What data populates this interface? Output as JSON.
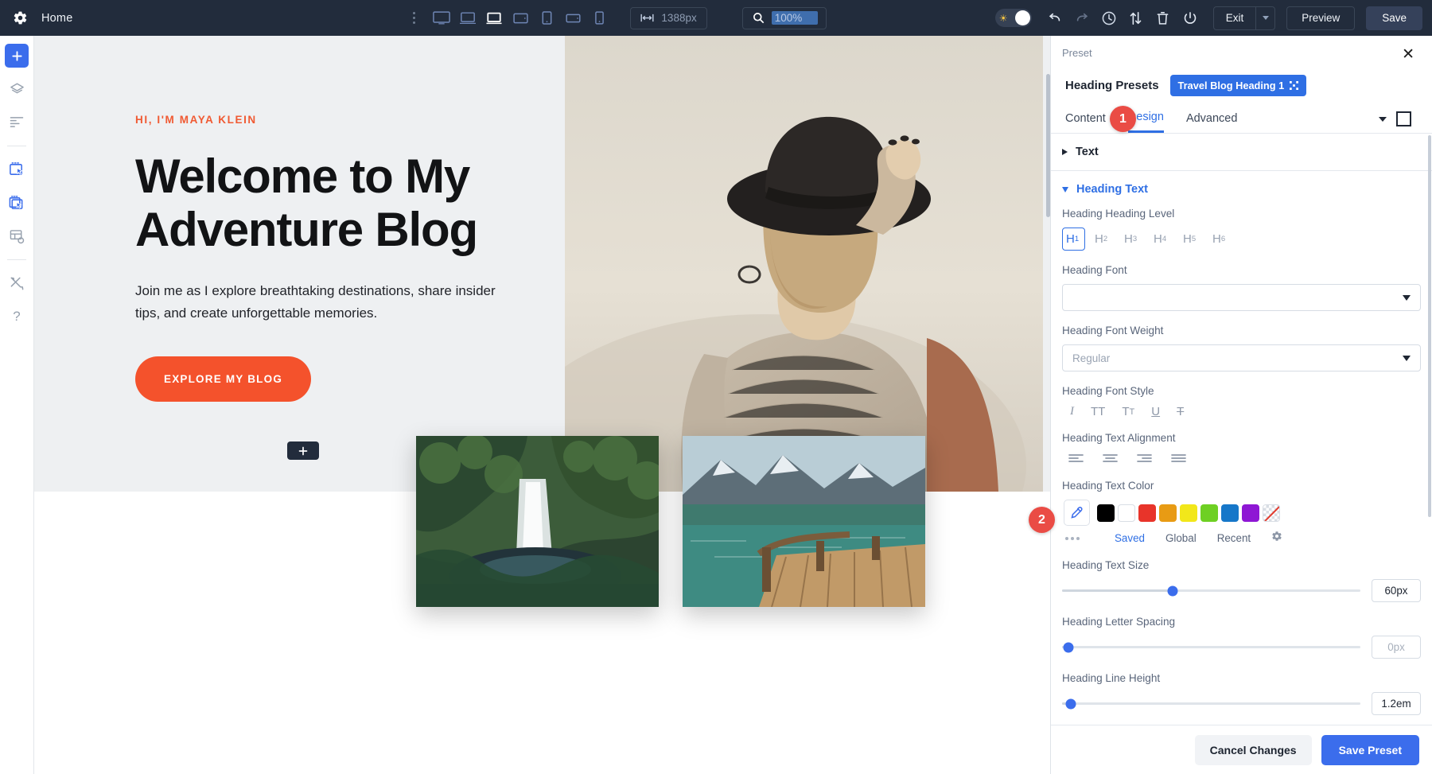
{
  "topbar": {
    "gear_icon": "gear-icon",
    "home_label": "Home",
    "devices": [
      "desktop-icon",
      "laptop-icon",
      "laptop-active-icon",
      "tablet-landscape-icon",
      "tablet-portrait-icon",
      "mobile-landscape-icon",
      "mobile-portrait-icon"
    ],
    "width_icon": "width-arrows-icon",
    "width_value": "1388px",
    "zoom_icon": "magnifier-icon",
    "zoom_value": "100%",
    "theme_toggle_icon": "sun-toggle",
    "undo_icon": "undo-icon",
    "redo_icon": "redo-icon",
    "history_icon": "clock-history-icon",
    "transfer_icon": "up-down-arrows-icon",
    "trash_icon": "trash-icon",
    "power_icon": "power-icon",
    "exit_label": "Exit",
    "exit_caret_icon": "chevron-down-icon",
    "preview_label": "Preview",
    "save_label": "Save"
  },
  "sidebar": {
    "items": [
      {
        "icon": "plus-icon",
        "name": "add"
      },
      {
        "icon": "layers-icon",
        "name": "layers"
      },
      {
        "icon": "list-icon",
        "name": "list"
      },
      {
        "icon": "select-element-icon",
        "name": "select-element"
      },
      {
        "icon": "select-module-icon",
        "name": "select-module"
      },
      {
        "icon": "grid-settings-icon",
        "name": "grid-settings"
      },
      {
        "icon": "tools-icon",
        "name": "tools"
      },
      {
        "icon": "help-icon",
        "name": "help"
      }
    ]
  },
  "canvas": {
    "eyebrow": "HI, I'M MAYA KLEIN",
    "heading": "Welcome to My Adventure Blog",
    "subtext": "Join me as I explore breathtaking destinations, share insider tips, and create unforgettable memories.",
    "cta_label": "EXPLORE MY BLOG",
    "add_section_icon": "plus-icon",
    "colors": {
      "accent": "#f4522c",
      "hero_bg": "#eef0f2"
    }
  },
  "panel": {
    "kicker": "Preset",
    "close_icon": "close-icon",
    "preset_label": "Heading Presets",
    "preset_value": "Travel Blog Heading 1",
    "preset_value_icon": "resize-icon",
    "tabs": [
      {
        "label": "Content",
        "active": false
      },
      {
        "label": "Design",
        "active": true
      },
      {
        "label": "Advanced",
        "active": false
      }
    ],
    "tabs_caret_icon": "chevron-down-icon",
    "tabs_square_icon": "square-outline-icon",
    "sections": [
      {
        "title": "Text",
        "expanded": false
      },
      {
        "title": "Heading Text",
        "expanded": true
      }
    ],
    "fields": {
      "heading_level_label": "Heading Heading Level",
      "heading_levels": [
        "H1",
        "H2",
        "H3",
        "H4",
        "H5",
        "H6"
      ],
      "heading_level_active": "H1",
      "font_label": "Heading Font",
      "font_value": "",
      "weight_label": "Heading Font Weight",
      "weight_value": "Regular",
      "style_label": "Heading Font Style",
      "style_icons": [
        "italic-icon",
        "uppercase-icon",
        "capitalize-icon",
        "underline-icon",
        "strikethrough-icon"
      ],
      "alignment_label": "Heading Text Alignment",
      "alignment_icons": [
        "align-left-icon",
        "align-center-icon",
        "align-right-icon",
        "align-justify-icon"
      ],
      "color_label": "Heading Text Color",
      "eyedropper_icon": "eyedropper-icon",
      "swatches": [
        "#000000",
        "#ffffff",
        "#e8342a",
        "#e89b14",
        "#f2e71a",
        "#6ed023",
        "#1677c9",
        "#8e17d4",
        "transparent"
      ],
      "color_tabs": [
        {
          "label": "Saved",
          "active": true
        },
        {
          "label": "Global",
          "active": false
        },
        {
          "label": "Recent",
          "active": false
        }
      ],
      "color_settings_icon": "gear-icon",
      "text_size_label": "Heading Text Size",
      "text_size_value": "60px",
      "text_size_percent": 37,
      "letter_spacing_label": "Heading Letter Spacing",
      "letter_spacing_value": "0px",
      "letter_spacing_percent": 2,
      "line_height_label": "Heading Line Height",
      "line_height_value": "1.2em",
      "line_height_percent": 3
    },
    "footer": {
      "cancel_label": "Cancel Changes",
      "save_label": "Save Preset"
    },
    "badges": [
      "1",
      "2"
    ]
  }
}
